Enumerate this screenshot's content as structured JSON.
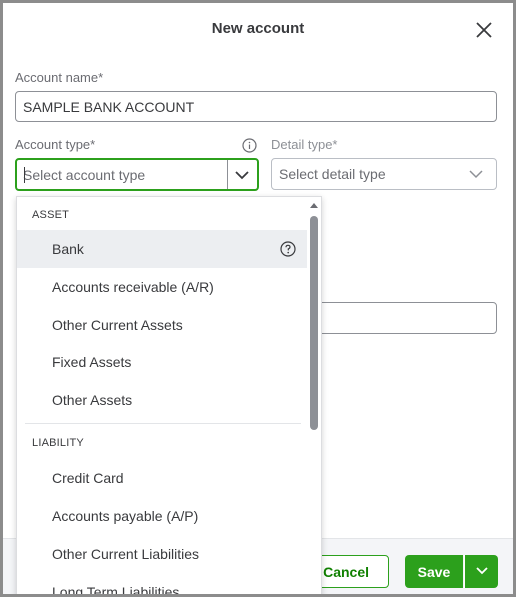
{
  "dialog": {
    "title": "New account"
  },
  "form": {
    "account_name_label": "Account name*",
    "account_name_value": "SAMPLE BANK ACCOUNT",
    "account_type_label": "Account type*",
    "account_type_placeholder": "Select account type",
    "detail_type_label": "Detail type*",
    "detail_type_placeholder": "Select detail type"
  },
  "dropdown": {
    "groups": [
      {
        "label": "ASSET",
        "options": [
          "Bank",
          "Accounts receivable (A/R)",
          "Other Current Assets",
          "Fixed Assets",
          "Other Assets"
        ]
      },
      {
        "label": "LIABILITY",
        "options": [
          "Credit Card",
          "Accounts payable (A/P)",
          "Other Current Liabilities",
          "Long Term Liabilities"
        ]
      }
    ],
    "selected_option": "Bank"
  },
  "footer": {
    "cancel_label": "Cancel",
    "save_label": "Save"
  },
  "colors": {
    "accent_green": "#2ca01c",
    "cancel_text": "#108000",
    "highlight_row": "#eceef1"
  },
  "icons": {
    "close": "close-icon",
    "info": "info-icon",
    "chevron": "chevron-down-icon",
    "help": "help-icon"
  }
}
